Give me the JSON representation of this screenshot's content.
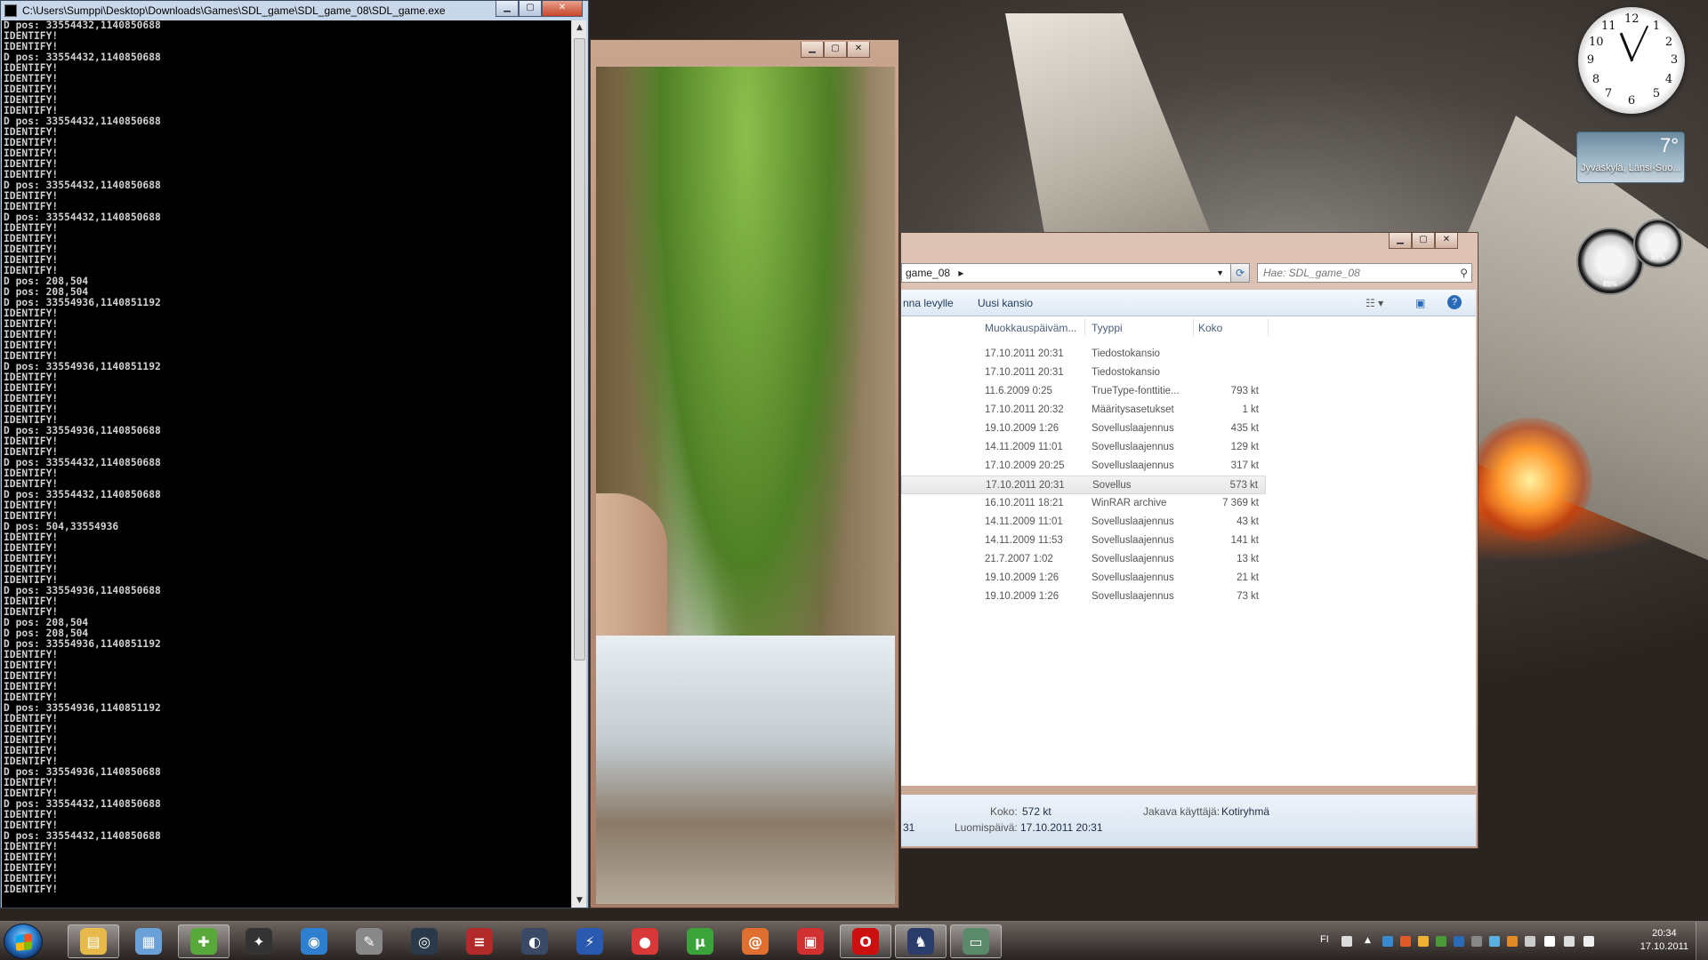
{
  "console": {
    "title": "C:\\Users\\Sumppi\\Desktop\\Downloads\\Games\\SDL_game\\SDL_game_08\\SDL_game.exe",
    "lines": [
      "D pos: 33554432,1140850688",
      "IDENTIFY!",
      "IDENTIFY!",
      "D pos: 33554432,1140850688",
      "IDENTIFY!",
      "IDENTIFY!",
      "IDENTIFY!",
      "IDENTIFY!",
      "IDENTIFY!",
      "D pos: 33554432,1140850688",
      "IDENTIFY!",
      "IDENTIFY!",
      "IDENTIFY!",
      "IDENTIFY!",
      "IDENTIFY!",
      "D pos: 33554432,1140850688",
      "IDENTIFY!",
      "IDENTIFY!",
      "D pos: 33554432,1140850688",
      "IDENTIFY!",
      "IDENTIFY!",
      "IDENTIFY!",
      "IDENTIFY!",
      "IDENTIFY!",
      "D pos: 208,504",
      "D pos: 208,504",
      "D pos: 33554936,1140851192",
      "IDENTIFY!",
      "IDENTIFY!",
      "IDENTIFY!",
      "IDENTIFY!",
      "IDENTIFY!",
      "D pos: 33554936,1140851192",
      "IDENTIFY!",
      "IDENTIFY!",
      "IDENTIFY!",
      "IDENTIFY!",
      "IDENTIFY!",
      "D pos: 33554936,1140850688",
      "IDENTIFY!",
      "IDENTIFY!",
      "D pos: 33554432,1140850688",
      "IDENTIFY!",
      "IDENTIFY!",
      "D pos: 33554432,1140850688",
      "IDENTIFY!",
      "IDENTIFY!",
      "D pos: 504,33554936",
      "IDENTIFY!",
      "IDENTIFY!",
      "IDENTIFY!",
      "IDENTIFY!",
      "IDENTIFY!",
      "D pos: 33554936,1140850688",
      "IDENTIFY!",
      "IDENTIFY!",
      "D pos: 208,504",
      "D pos: 208,504",
      "D pos: 33554936,1140851192",
      "IDENTIFY!",
      "IDENTIFY!",
      "IDENTIFY!",
      "IDENTIFY!",
      "IDENTIFY!",
      "D pos: 33554936,1140851192",
      "IDENTIFY!",
      "IDENTIFY!",
      "IDENTIFY!",
      "IDENTIFY!",
      "IDENTIFY!",
      "D pos: 33554936,1140850688",
      "IDENTIFY!",
      "IDENTIFY!",
      "D pos: 33554432,1140850688",
      "IDENTIFY!",
      "IDENTIFY!",
      "D pos: 33554432,1140850688",
      "IDENTIFY!",
      "IDENTIFY!",
      "IDENTIFY!",
      "IDENTIFY!",
      "IDENTIFY!"
    ]
  },
  "explorer": {
    "address_tail": "game_08",
    "search_placeholder": "Hae: SDL_game_08",
    "toolbar": {
      "burn_label": "nna levylle",
      "new_folder_label": "Uusi kansio"
    },
    "columns": {
      "modified": "Muokkauspäiväm...",
      "type": "Tyyppi",
      "size": "Koko"
    },
    "rows": [
      {
        "date": "17.10.2011 20:31",
        "type": "Tiedostokansio",
        "size": ""
      },
      {
        "date": "17.10.2011 20:31",
        "type": "Tiedostokansio",
        "size": ""
      },
      {
        "date": "11.6.2009 0:25",
        "type": "TrueType-fonttitie...",
        "size": "793 kt"
      },
      {
        "date": "17.10.2011 20:32",
        "type": "Määritysasetukset",
        "size": "1 kt"
      },
      {
        "date": "19.10.2009 1:26",
        "type": "Sovelluslaajennus",
        "size": "435 kt"
      },
      {
        "date": "14.11.2009 11:01",
        "type": "Sovelluslaajennus",
        "size": "129 kt"
      },
      {
        "date": "17.10.2009 20:25",
        "type": "Sovelluslaajennus",
        "size": "317 kt"
      },
      {
        "date": "17.10.2011 20:31",
        "type": "Sovellus",
        "size": "573 kt"
      },
      {
        "date": "16.10.2011 18:21",
        "type": "WinRAR archive",
        "size": "7 369 kt"
      },
      {
        "date": "14.11.2009 11:01",
        "type": "Sovelluslaajennus",
        "size": "43 kt"
      },
      {
        "date": "14.11.2009 11:53",
        "type": "Sovelluslaajennus",
        "size": "141 kt"
      },
      {
        "date": "21.7.2007 1:02",
        "type": "Sovelluslaajennus",
        "size": "13 kt"
      },
      {
        "date": "19.10.2009 1:26",
        "type": "Sovelluslaajennus",
        "size": "21 kt"
      },
      {
        "date": "19.10.2009 1:26",
        "type": "Sovelluslaajennus",
        "size": "73 kt"
      }
    ],
    "selected_row": 7,
    "details": {
      "size_label": "Koko:",
      "size_value": "572 kt",
      "shared_label": "Jakava käyttäjä:",
      "shared_value": "Kotiryhmä",
      "created_label": "Luomispäivä:",
      "created_value": "17.10.2011 20:31",
      "left_fragment": "31"
    }
  },
  "gadgets": {
    "weather": {
      "temp": "7°",
      "location": "Jyväskylä, Länsi-Suo..."
    },
    "cpu_meter": {
      "value": "89%"
    },
    "ram_meter": {
      "value": "66%"
    }
  },
  "taskbar": {
    "apps": [
      {
        "name": "explorer",
        "icon": "folder-icon",
        "color": "#e7b94a",
        "glyph": "▤",
        "active": true
      },
      {
        "name": "notepad",
        "icon": "document-icon",
        "color": "#6aa0d8",
        "glyph": "▦",
        "active": false
      },
      {
        "name": "network",
        "icon": "network-icon",
        "color": "#58a83c",
        "glyph": "✚",
        "active": true
      },
      {
        "name": "fox",
        "icon": "fox-icon",
        "color": "#333333",
        "glyph": "✦",
        "active": false
      },
      {
        "name": "browser",
        "icon": "globe-icon",
        "color": "#2f7fd0",
        "glyph": "◉",
        "active": false
      },
      {
        "name": "tool",
        "icon": "tool-icon",
        "color": "#888888",
        "glyph": "✎",
        "active": false
      },
      {
        "name": "steam",
        "icon": "steam-icon",
        "color": "#2a3a4a",
        "glyph": "◎",
        "active": false
      },
      {
        "name": "stripes",
        "icon": "stripes-icon",
        "color": "#b22a2a",
        "glyph": "≡",
        "active": false
      },
      {
        "name": "game",
        "icon": "crescent-icon",
        "color": "#3a4a66",
        "glyph": "◐",
        "active": false
      },
      {
        "name": "winamp",
        "icon": "lightning-icon",
        "color": "#2a5ab0",
        "glyph": "⚡",
        "active": false
      },
      {
        "name": "os",
        "icon": "os-icon",
        "color": "#d83838",
        "glyph": "●",
        "active": false
      },
      {
        "name": "utorrent",
        "icon": "utorrent-icon",
        "color": "#3aa43a",
        "glyph": "μ",
        "active": false
      },
      {
        "name": "swirl",
        "icon": "swirl-icon",
        "color": "#e07030",
        "glyph": "@",
        "active": false
      },
      {
        "name": "paint",
        "icon": "paint-icon",
        "color": "#d03030",
        "glyph": "▣",
        "active": false
      },
      {
        "name": "opera",
        "icon": "opera-icon",
        "color": "#cc1010",
        "glyph": "O",
        "active": true
      },
      {
        "name": "crest",
        "icon": "crest-icon",
        "color": "#2a3c6a",
        "glyph": "♞",
        "active": true
      },
      {
        "name": "viewer",
        "icon": "image-viewer-icon",
        "color": "#5a8a6a",
        "glyph": "▭",
        "active": true
      }
    ],
    "tray": {
      "lang": "FI",
      "time": "20:34",
      "date": "17.10.2011"
    }
  },
  "colors": {
    "accent": "#2a6ab6",
    "console_bg": "#000000",
    "console_fg": "#d0d0d0"
  }
}
